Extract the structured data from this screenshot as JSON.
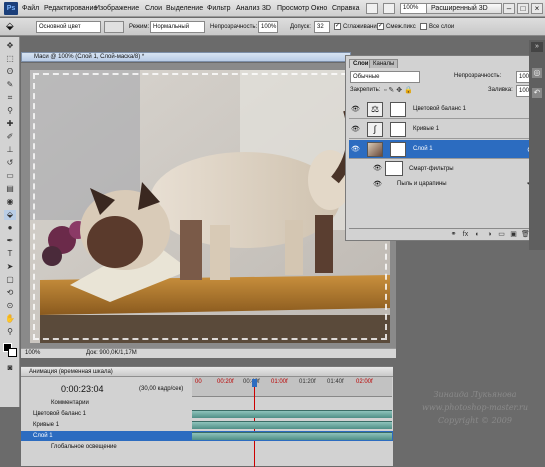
{
  "menubar": {
    "logo": "Ps",
    "items": [
      "Файл",
      "Редактирование",
      "Изображение",
      "Слои",
      "Выделение",
      "Фильтр",
      "Анализ",
      "3D",
      "Просмотр",
      "Окно",
      "Справка"
    ],
    "zoom": "100%",
    "workspace": "Расширенный 3D",
    "win_min": "–",
    "win_max": "□",
    "win_close": "×"
  },
  "options": {
    "brush_mode": "Основной цвет",
    "mode_label": "Режим:",
    "mode_value": "Нормальный",
    "opacity_label": "Непрозрачность:",
    "opacity_value": "100%",
    "tolerance_label": "Допуск:",
    "tolerance_value": "32",
    "antialias_label": "Сглаживание",
    "contiguous_label": "Смеж.пикс",
    "all_layers_label": "Все слои"
  },
  "document": {
    "tab_title": "Маси @ 100% (Слой 1, Слой-маска/8) *",
    "status_zoom": "100%",
    "status_info": "Док: 900,0K/1,17M"
  },
  "layers_panel": {
    "tab_layers": "Слои",
    "tab_channels": "Каналы",
    "blend_mode": "Обычные",
    "opacity_label": "Непрозрачность:",
    "opacity_value": "100%",
    "lock_label": "Закрепить:",
    "fill_label": "Заливка:",
    "fill_value": "100%",
    "layers": [
      {
        "name": "Цветовой баланс 1"
      },
      {
        "name": "Кривые 1"
      },
      {
        "name": "Слой 1"
      }
    ],
    "smart_filters": "Смарт-фильтры",
    "filter_item": "Пыль и царапины"
  },
  "animation": {
    "title": "Анимация (временная шкала)",
    "timecode": "0:00:23:04",
    "fps": "(30,00 кадр/сек)",
    "ruler": [
      "00",
      "00:20f",
      "00:40f",
      "01:00f",
      "01:20f",
      "01:40f",
      "02:00f"
    ],
    "tracks": [
      "Комментарии",
      "Цветовой баланс 1",
      "Кривые 1",
      "Слой 1",
      "Глобальное освещение"
    ]
  },
  "watermark": {
    "line1": "Зинаида Лукьянова",
    "line2": "www.photoshop-master.ru",
    "line3": "Copyright © 2009"
  },
  "colors": {
    "selection_blue": "#2c6cc0",
    "track_teal": "#5b9b93",
    "playhead_red": "#cc0000"
  }
}
